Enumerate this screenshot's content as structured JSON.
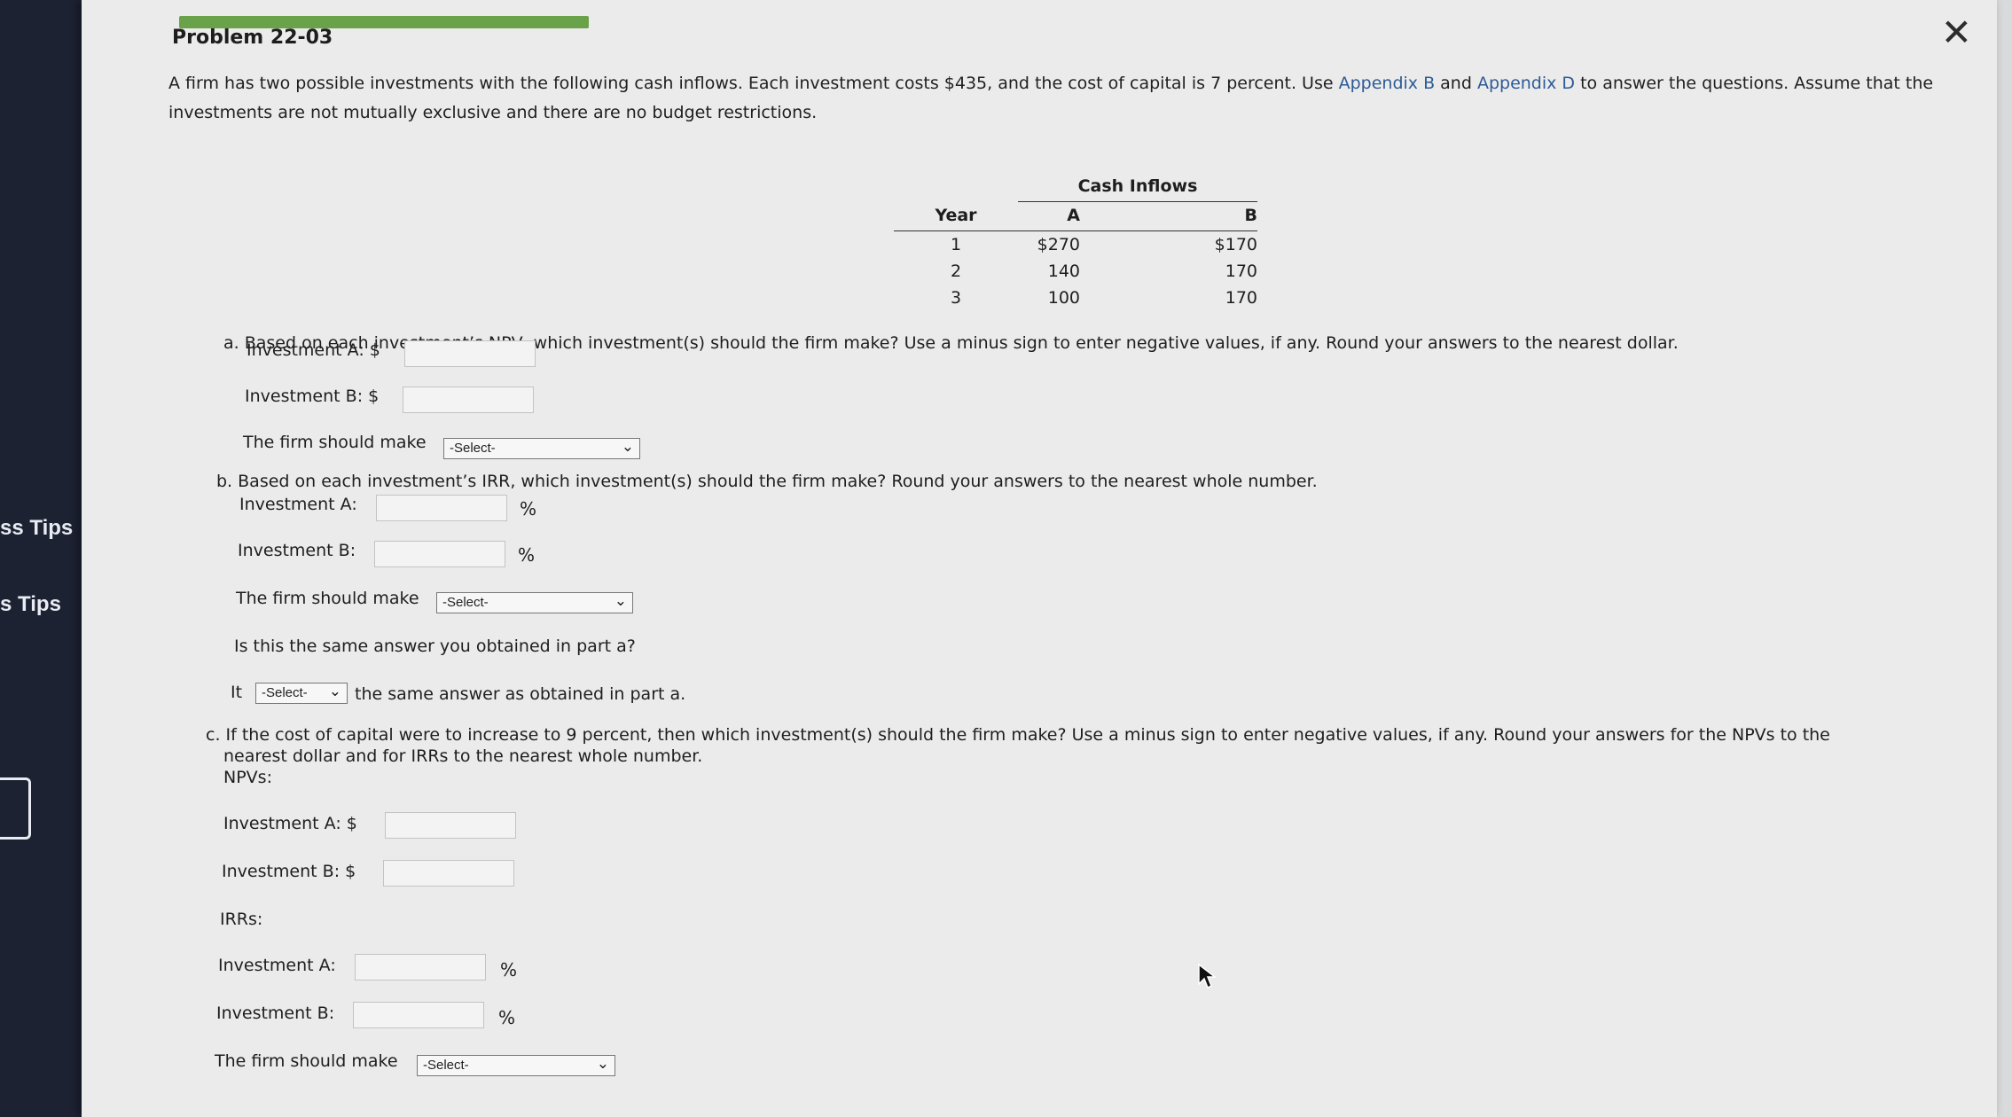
{
  "sidebar": {
    "tips": [
      "ss Tips",
      "s Tips"
    ]
  },
  "header": {
    "title": "Problem 22-03"
  },
  "intro": {
    "text1": "A firm has two possible investments with the following cash inflows. Each investment costs $435, and the cost of capital is 7 percent. Use",
    "link1": "Appendix B",
    "and": "and",
    "link2": "Appendix D",
    "text2": "to answer the questions. Assume that the investments are not mutually exclusive and there are no budget restrictions."
  },
  "table": {
    "group_header": "Cash Inflows",
    "col_year": "Year",
    "col_a": "A",
    "col_b": "B",
    "rows": [
      {
        "year": "1",
        "a": "$270",
        "b": "$170"
      },
      {
        "year": "2",
        "a": "140",
        "b": "170"
      },
      {
        "year": "3",
        "a": "100",
        "b": "170"
      }
    ]
  },
  "part_a": {
    "question": "a. Based on each investment’s NPV, which investment(s) should the firm make? Use a minus sign to enter negative values, if any. Round your answers to the nearest dollar.",
    "inv_a_label": "Investment A: $",
    "inv_b_label": "Investment B: $",
    "firm_label": "The firm should make",
    "select_value": "-Select-"
  },
  "part_b": {
    "question": "b. Based on each investment’s IRR, which investment(s) should the firm make? Round your answers to the nearest whole number.",
    "inv_a_label": "Investment A:",
    "inv_b_label": "Investment B:",
    "pct": "%",
    "firm_label": "The firm should make",
    "select_value": "-Select-",
    "same_question": "Is this the same answer you obtained in part a?",
    "it_label": "It",
    "same_select": "-Select-",
    "same_tail": "the same answer as obtained in part a."
  },
  "part_c": {
    "question_line1": "c. If the cost of capital were to increase to 9 percent, then which investment(s) should the firm make? Use a minus sign to enter negative values, if any. Round your answers for the NPVs to the",
    "question_line2": "nearest dollar and for IRRs to the nearest whole number.",
    "npvs_label": "NPVs:",
    "inv_a_label": "Investment A: $",
    "inv_b_label": "Investment B: $",
    "irrs_label": "IRRs:",
    "irr_a_label": "Investment A:",
    "irr_b_label": "Investment B:",
    "pct": "%",
    "firm_label": "The firm should make",
    "select_value": "-Select-"
  }
}
